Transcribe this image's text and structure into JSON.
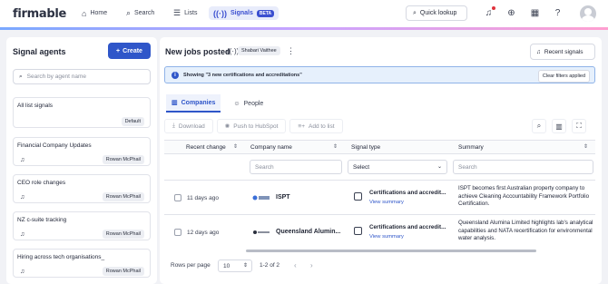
{
  "app": {
    "logo": "firmable"
  },
  "nav": {
    "home": "Home",
    "search": "Search",
    "lists": "Lists",
    "signals": "Signals",
    "beta": "BETA",
    "quick_lookup": "Quick lookup"
  },
  "sidebar": {
    "title": "Signal agents",
    "create": "Create",
    "search_placeholder": "Search by agent name",
    "cards": [
      {
        "title": "All list signals",
        "tag": "Default"
      },
      {
        "title": "Financial Company Updates",
        "tag": "Rowan McPhail"
      },
      {
        "title": "CEO role changes",
        "tag": "Rowan McPhail"
      },
      {
        "title": "NZ c-suite tracking",
        "tag": "Rowan McPhail"
      },
      {
        "title": "Hiring across tech organisations_",
        "tag": "Rowan McPhail"
      }
    ]
  },
  "main": {
    "title": "New jobs posted",
    "owner": "Shabari Vaithee",
    "recent_signals": "Recent signals",
    "banner": "Showing \"3 new certifications and accreditations\"",
    "clear_filters": "Clear filters applied",
    "tabs": {
      "companies": "Companies",
      "people": "People"
    },
    "toolbar": {
      "download": "Download",
      "hubspot": "Push to HubSpot",
      "add_list": "Add to list"
    },
    "columns": {
      "recent_change": "Recent change",
      "company_name": "Company name",
      "signal_type": "Signal type",
      "summary": "Summary"
    },
    "filters": {
      "company_placeholder": "Search",
      "signal_select": "Select",
      "summary_placeholder": "Search"
    },
    "rows": [
      {
        "recent": "11 days ago",
        "company": "ISPT",
        "signal": "Certifications and accredit...",
        "view": "View summary",
        "summary": "ISPT becomes first Australian property company to achieve Cleaning Accountability Framework Portfolio Certification."
      },
      {
        "recent": "12 days ago",
        "company": "Queensland Alumin...",
        "signal": "Certifications and accredit...",
        "view": "View summary",
        "summary": "Queensland Alumina Limited highlights lab's analytical capabilities and NATA recertification for environmental water analysis."
      }
    ],
    "footer": {
      "rows_per_page": "Rows per page",
      "page_size": "10",
      "range": "1-2 of 2"
    }
  }
}
